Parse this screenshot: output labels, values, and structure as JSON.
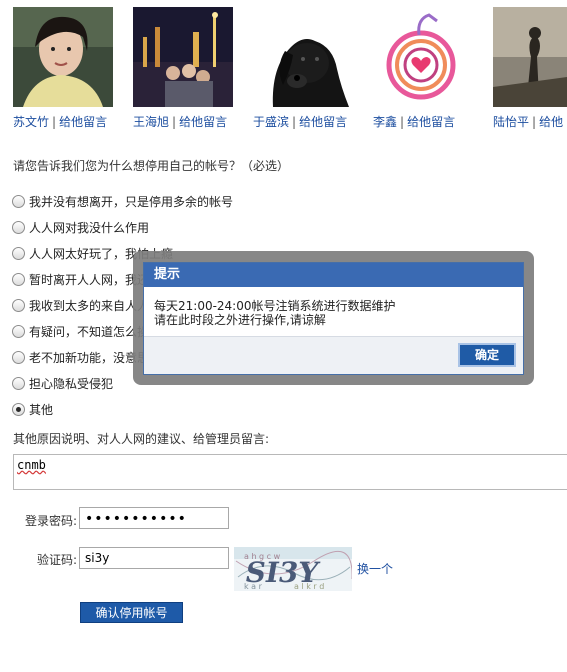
{
  "friends": [
    {
      "name": "苏文竹",
      "action": "给他留言",
      "photo": "young-woman-photo-icon"
    },
    {
      "name": "王海旭",
      "action": "给他留言",
      "photo": "night-city-group-photo-icon"
    },
    {
      "name": "于盛滨",
      "action": "给他留言",
      "photo": "black-dog-photo-icon"
    },
    {
      "name": "李鑫",
      "action": "给他留言",
      "photo": "heart-fruit-drawing-icon"
    },
    {
      "name": "陆怡平",
      "action": "给他",
      "photo": "silhouette-photo-icon"
    }
  ],
  "form": {
    "question": "请您告诉我们您为什么想停用自己的帐号？（必选）",
    "reasons": [
      {
        "label": "我并没有想离开，只是停用多余的帐号",
        "checked": false
      },
      {
        "label": "人人网对我没什么作用",
        "checked": false
      },
      {
        "label": "人人网太好玩了，我怕上瘾",
        "checked": false
      },
      {
        "label": "暂时离开人人网，我还",
        "checked": false
      },
      {
        "label": "我收到太多的来自人人",
        "checked": false
      },
      {
        "label": "有疑问，不知道怎么操",
        "checked": false
      },
      {
        "label": "老不加新功能，没意思",
        "checked": false
      },
      {
        "label": "担心隐私受侵犯",
        "checked": false
      },
      {
        "label": "其他",
        "checked": true
      }
    ],
    "other_label": "其他原因说明、对人人网的建议、给管理员留言:",
    "comment_value": "cnmb",
    "password_label": "登录密码:",
    "password_value": "•••••••••••",
    "code_label": "验证码:",
    "code_value": "si3y",
    "captcha_text": "SI3Y",
    "change_link": "换一个",
    "submit_label": "确认停用帐号"
  },
  "dialog": {
    "title": "提示",
    "line1": "每天21:00-24:00帐号注销系统进行数据维护",
    "line2": "请在此时段之外进行操作,请谅解",
    "ok_label": "确定"
  },
  "colors": {
    "link": "#1e4fa0",
    "dialog_title_bg": "#3a6ab3",
    "button_bg": "#1e5aa8"
  }
}
